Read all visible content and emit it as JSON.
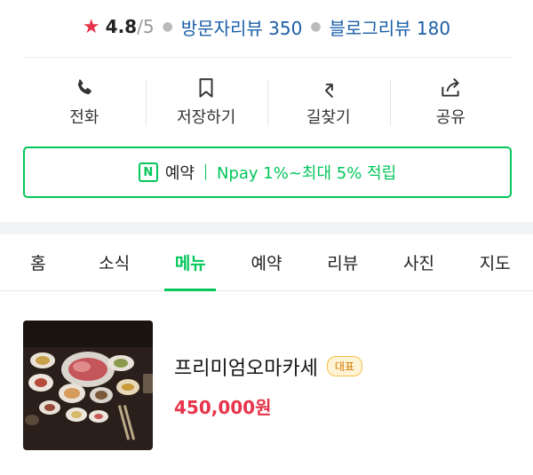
{
  "header": {
    "rating_star": "★",
    "rating_score": "4.8",
    "rating_max": "/5",
    "visitor_reviews": "방문자리뷰 350",
    "blog_reviews": "블로그리뷰 180"
  },
  "actions": [
    {
      "label": "전화",
      "icon": "phone-icon"
    },
    {
      "label": "저장하기",
      "icon": "bookmark-icon"
    },
    {
      "label": "길찾기",
      "icon": "directions-icon"
    },
    {
      "label": "공유",
      "icon": "share-icon"
    }
  ],
  "reservation": {
    "icon_letter": "N",
    "label": "예약",
    "promo": "Npay 1%~최대 5% 적립"
  },
  "tabs": [
    "홈",
    "소식",
    "메뉴",
    "예약",
    "리뷰",
    "사진",
    "지도"
  ],
  "active_tab": "메뉴",
  "menu": {
    "name": "프리미엄오마카세",
    "badge": "대표",
    "price": "450,000원"
  },
  "colors": {
    "accent_green": "#03c75a",
    "star_red": "#e8344a",
    "link_blue": "#1b5fa8",
    "badge_orange": "#d07c00"
  }
}
